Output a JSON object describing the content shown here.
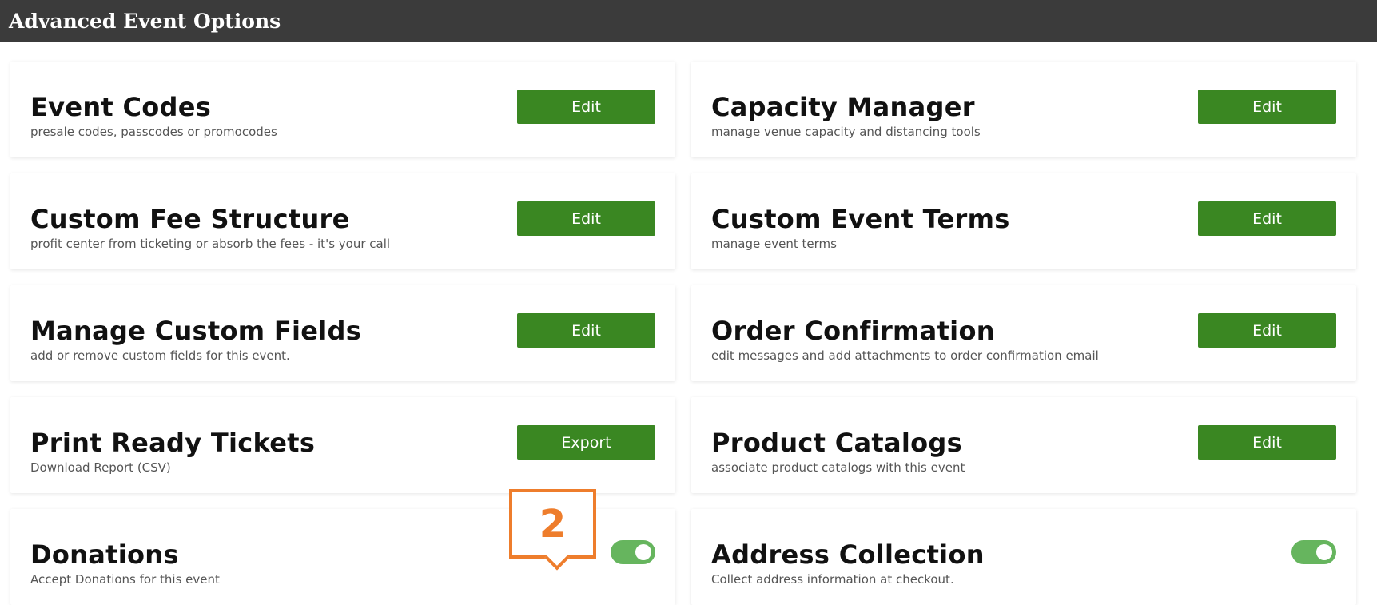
{
  "header": {
    "title": "Advanced Event Options"
  },
  "cards": [
    {
      "title": "Event Codes",
      "subtitle": "presale codes, passcodes or promocodes",
      "button": "Edit"
    },
    {
      "title": "Capacity Manager",
      "subtitle": "manage venue capacity and distancing tools",
      "button": "Edit"
    },
    {
      "title": "Custom Fee Structure",
      "subtitle": "profit center from ticketing or absorb the fees - it's your call",
      "button": "Edit"
    },
    {
      "title": "Custom Event Terms",
      "subtitle": "manage event terms",
      "button": "Edit"
    },
    {
      "title": "Manage Custom Fields",
      "subtitle": "add or remove custom fields for this event.",
      "button": "Edit"
    },
    {
      "title": "Order Confirmation",
      "subtitle": "edit messages and add attachments to order confirmation email",
      "button": "Edit"
    },
    {
      "title": "Print Ready Tickets",
      "subtitle": "Download Report (CSV)",
      "button": "Export"
    },
    {
      "title": "Product Catalogs",
      "subtitle": "associate product catalogs with this event",
      "button": "Edit"
    },
    {
      "title": "Donations",
      "subtitle": "Accept Donations for this event",
      "toggle": "on"
    },
    {
      "title": "Address Collection",
      "subtitle": "Collect address information at checkout.",
      "toggle": "on"
    }
  ],
  "annotation": {
    "label": "2",
    "color": "#ee7d2c"
  },
  "colors": {
    "header_bg": "#3b3b3b",
    "button_bg": "#3a8722",
    "toggle_on": "#66b55e"
  }
}
